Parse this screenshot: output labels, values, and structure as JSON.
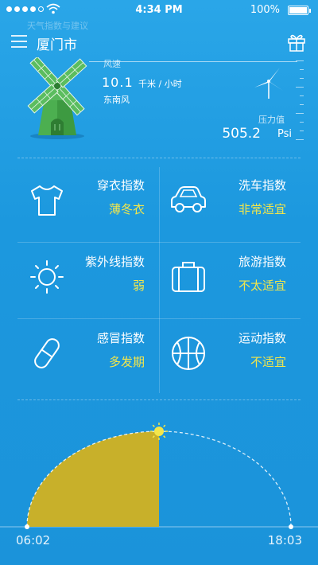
{
  "status": {
    "time": "4:34 PM",
    "battery_pct": "100%"
  },
  "ghost_text": "天气指数与建议",
  "header": {
    "city": "厦门市"
  },
  "wind": {
    "label": "风速",
    "value": "10.1",
    "unit": "千米 / 小时",
    "direction": "东南风"
  },
  "pressure": {
    "label": "压力值",
    "value": "505.2",
    "unit": "Psi"
  },
  "indices": [
    {
      "label": "穿衣指数",
      "value": "薄冬衣",
      "icon": "tshirt-icon"
    },
    {
      "label": "洗车指数",
      "value": "非常适宜",
      "icon": "car-icon"
    },
    {
      "label": "紫外线指数",
      "value": "弱",
      "icon": "sun-icon"
    },
    {
      "label": "旅游指数",
      "value": "不太适宜",
      "icon": "suitcase-icon"
    },
    {
      "label": "感冒指数",
      "value": "多发期",
      "icon": "pill-icon"
    },
    {
      "label": "运动指数",
      "value": "不适宜",
      "icon": "basketball-icon"
    }
  ],
  "sun": {
    "sunrise": "06:02",
    "sunset": "18:03",
    "progress": 0.5
  },
  "colors": {
    "background": "#1b98de",
    "accent_value": "#f3e64b",
    "sun_fill": "#c8b02a",
    "windmill_green": "#4caf50"
  }
}
